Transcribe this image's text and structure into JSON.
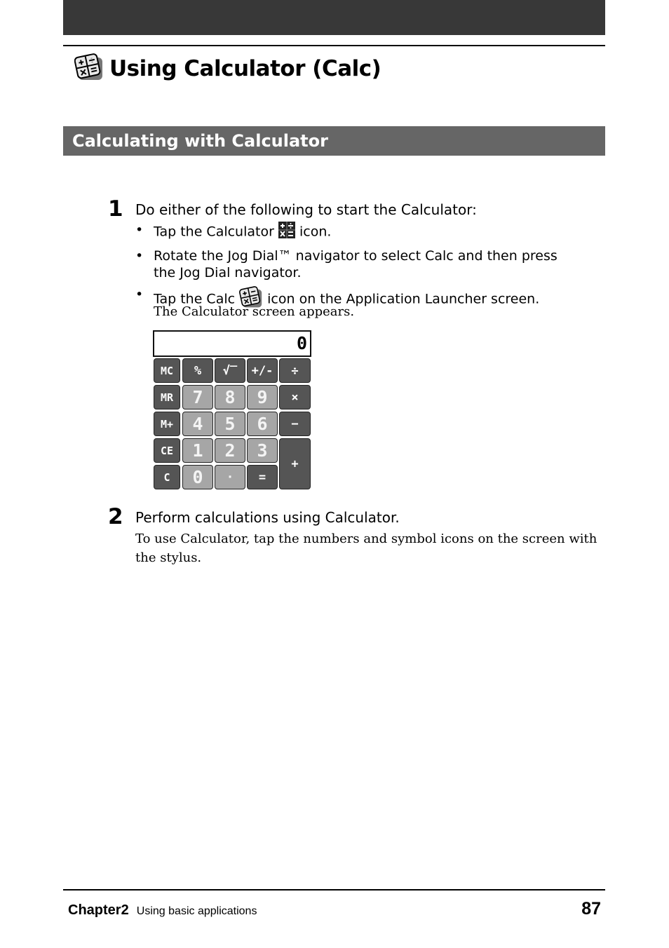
{
  "page": {
    "title": "Using Calculator (Calc)",
    "section_title": "Calculating with Calculator"
  },
  "steps": [
    {
      "number": "1",
      "heading": "Do either of the following to start the Calculator:",
      "bullets": [
        {
          "before": "Tap the Calculator",
          "icon": "calculator-icon",
          "after": "icon."
        },
        {
          "text": "Rotate the Jog Dial™ navigator to select Calc and then press the Jog Dial navigator."
        },
        {
          "before": "Tap the Calc",
          "icon": "calc-app-icon",
          "after": "icon on the Application Launcher screen."
        }
      ],
      "note": "The Calculator screen appears."
    },
    {
      "number": "2",
      "heading": "Perform calculations using Calculator.",
      "note": "To use Calculator, tap the numbers and symbol icons on the screen with the stylus."
    }
  ],
  "calculator": {
    "display": "0",
    "keys": {
      "mc": "MC",
      "percent": "%",
      "sqrt": "√‾",
      "plusminus": "+/-",
      "divide": "÷",
      "mr": "MR",
      "k7": "7",
      "k8": "8",
      "k9": "9",
      "multiply": "×",
      "mplus": "M+",
      "k4": "4",
      "k5": "5",
      "k6": "6",
      "minus": "−",
      "ce": "CE",
      "k1": "1",
      "k2": "2",
      "k3": "3",
      "plus": "+",
      "c": "C",
      "k0": "0",
      "dot": "·",
      "equals": "="
    }
  },
  "footer": {
    "chapter": "Chapter2",
    "chapter_title": "Using basic applications",
    "page_number": "87"
  }
}
